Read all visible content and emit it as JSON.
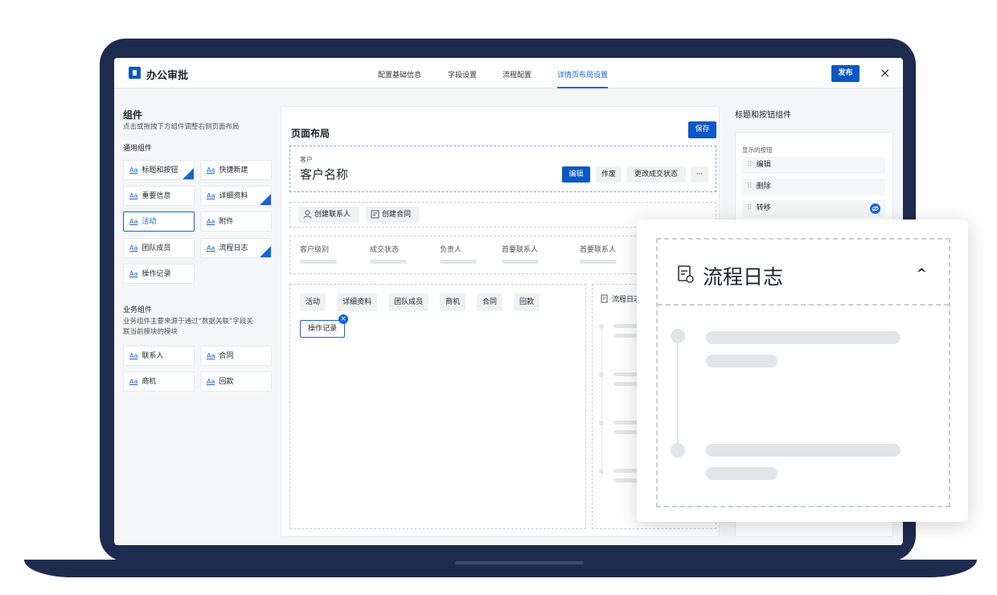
{
  "app": {
    "title": "办公审批"
  },
  "tabs": [
    {
      "label": "配置基础信息"
    },
    {
      "label": "字段设置"
    },
    {
      "label": "流程配置"
    },
    {
      "label": "详情页布局设置"
    }
  ],
  "header": {
    "publish_label": "发布",
    "close_icon": "×"
  },
  "left": {
    "title": "组件",
    "hint": "点击或拖拽下方组件调整右侧页面布局",
    "general_title": "通用组件",
    "aa": "Aa",
    "general": [
      {
        "label": "标题和按钮",
        "added": true
      },
      {
        "label": "快捷新建",
        "added": false
      },
      {
        "label": "重要信息",
        "added": false
      },
      {
        "label": "详细资料",
        "added": true
      },
      {
        "label": "活动",
        "added": false,
        "selected": true
      },
      {
        "label": "附件",
        "added": false
      },
      {
        "label": "团队成员",
        "added": false
      },
      {
        "label": "流程日志",
        "added": true
      },
      {
        "label": "操作记录",
        "added": false
      }
    ],
    "biz_title": "业务组件",
    "biz_hint_1": "业务组件主要来源于通过“数据关联”字段关",
    "biz_hint_2": "联当前模块的模块",
    "biz": [
      {
        "label": "联系人"
      },
      {
        "label": "合同"
      },
      {
        "label": "商机"
      },
      {
        "label": "回款"
      }
    ]
  },
  "middle": {
    "title": "页面布局",
    "save_label": "保存",
    "record_type": "客户",
    "record_name": "客户名称",
    "actions": {
      "edit": "编辑",
      "void": "作废",
      "change_status": "更改成交状态",
      "more": "···"
    },
    "quick": [
      {
        "label": "创建联系人"
      },
      {
        "label": "创建合同"
      }
    ],
    "fields": [
      {
        "label": "客户级别"
      },
      {
        "label": "成交状态"
      },
      {
        "label": "负责人"
      },
      {
        "label": "首要联系人"
      },
      {
        "label": "首要联系人"
      }
    ],
    "tabs": [
      {
        "label": "活动"
      },
      {
        "label": "详细资料"
      },
      {
        "label": "团队成员"
      },
      {
        "label": "商机"
      },
      {
        "label": "合同"
      },
      {
        "label": "回款"
      }
    ],
    "dragging_tab": "操作记录",
    "side_title": "流程日志"
  },
  "right": {
    "title": "标题和按钮组件",
    "shown_label": "显示的按钮",
    "buttons": [
      {
        "label": "编辑"
      },
      {
        "label": "删除"
      },
      {
        "label": "转移"
      }
    ]
  },
  "popup": {
    "title": "流程日志"
  }
}
